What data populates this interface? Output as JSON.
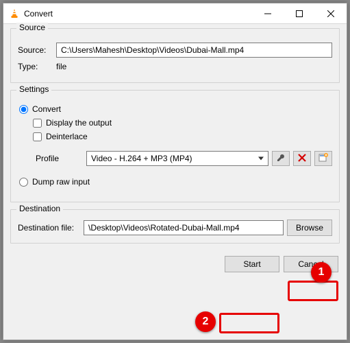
{
  "window": {
    "title": "Convert"
  },
  "source": {
    "group_label": "Source",
    "source_label": "Source:",
    "source_value": "C:\\Users\\Mahesh\\Desktop\\Videos\\Dubai-Mall.mp4",
    "type_label": "Type:",
    "type_value": "file"
  },
  "settings": {
    "group_label": "Settings",
    "convert_label": "Convert",
    "display_output_label": "Display the output",
    "deinterlace_label": "Deinterlace",
    "profile_label": "Profile",
    "profile_value": "Video - H.264 + MP3 (MP4)",
    "dump_label": "Dump raw input"
  },
  "destination": {
    "group_label": "Destination",
    "dest_label": "Destination file:",
    "dest_value": "\\Desktop\\Videos\\Rotated-Dubai-Mall.mp4",
    "browse_label": "Browse"
  },
  "footer": {
    "start_label": "Start",
    "cancel_label": "Cancel"
  },
  "annotations": {
    "one": "1",
    "two": "2"
  }
}
